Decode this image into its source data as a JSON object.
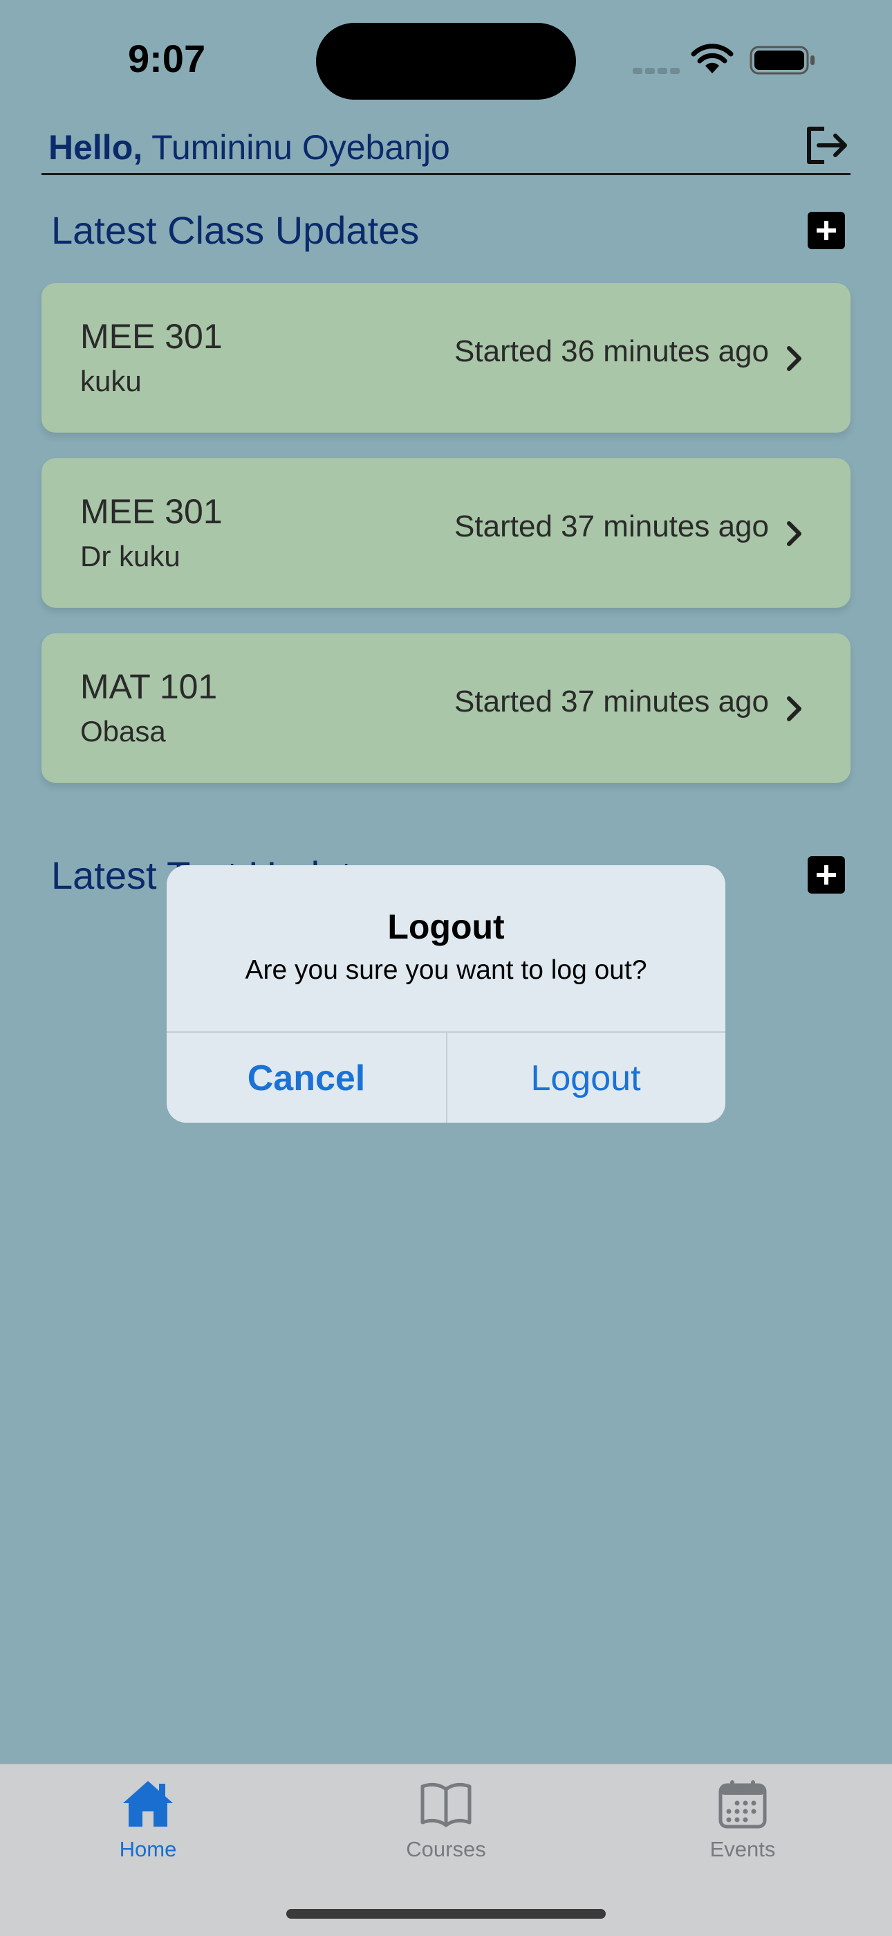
{
  "status_bar": {
    "time": "9:07"
  },
  "header": {
    "greeting_prefix": "Hello,",
    "user_name": "Tumininu Oyebanjo"
  },
  "sections": {
    "class_updates": {
      "title": "Latest Class Updates"
    },
    "test_updates": {
      "title": "Latest Test Updates"
    }
  },
  "class_updates": [
    {
      "course": "MEE 301",
      "lecturer": "kuku",
      "time": "Started 36 minutes ago"
    },
    {
      "course": "MEE 301",
      "lecturer": "Dr kuku",
      "time": "Started 37 minutes ago"
    },
    {
      "course": "MAT 101",
      "lecturer": "Obasa",
      "time": "Started 37 minutes ago"
    }
  ],
  "dialog": {
    "title": "Logout",
    "message": "Are you sure you want to log out?",
    "cancel_label": "Cancel",
    "confirm_label": "Logout"
  },
  "tabbar": {
    "items": [
      {
        "label": "Home",
        "icon": "house-icon",
        "active": true
      },
      {
        "label": "Courses",
        "icon": "book-icon",
        "active": false
      },
      {
        "label": "Events",
        "icon": "calendar-icon",
        "active": false
      }
    ]
  },
  "colors": {
    "background": "#88abb5",
    "card": "#a9c6a8",
    "title_text": "#0a2a6b",
    "accent": "#1a72d6",
    "dialog": "#dfe9ef",
    "tabbar": "#cecfd0"
  }
}
